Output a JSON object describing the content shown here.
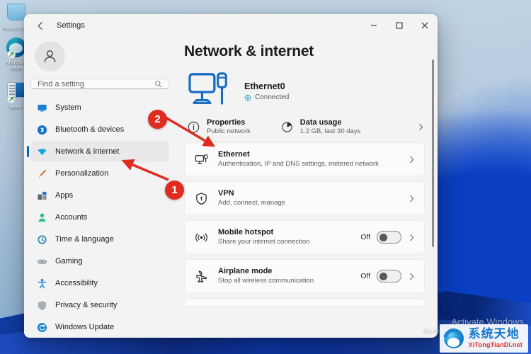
{
  "desktop": {
    "icons": [
      {
        "label": "Recycle Bin",
        "icon": "recycle-bin-icon",
        "shortcut": false
      },
      {
        "label": "Microsoft Edge",
        "icon": "microsoft-edge-icon",
        "shortcut": true
      },
      {
        "label": "taskm",
        "icon": "task-manager-icon",
        "shortcut": true
      }
    ]
  },
  "window": {
    "title": "Settings",
    "back_icon": "back-arrow-icon",
    "controls": {
      "minimize": "minimize-icon",
      "maximize": "maximize-icon",
      "close": "close-icon"
    }
  },
  "sidebar": {
    "avatar_icon": "user-avatar-icon",
    "search": {
      "placeholder": "Find a setting",
      "value": "",
      "icon": "search-icon"
    },
    "items": [
      {
        "label": "System",
        "icon": "system-icon",
        "active": false
      },
      {
        "label": "Bluetooth & devices",
        "icon": "bluetooth-icon",
        "active": false
      },
      {
        "label": "Network & internet",
        "icon": "wifi-icon",
        "active": true
      },
      {
        "label": "Personalization",
        "icon": "brush-icon",
        "active": false
      },
      {
        "label": "Apps",
        "icon": "apps-icon",
        "active": false
      },
      {
        "label": "Accounts",
        "icon": "accounts-icon",
        "active": false
      },
      {
        "label": "Time & language",
        "icon": "clock-icon",
        "active": false
      },
      {
        "label": "Gaming",
        "icon": "gamepad-icon",
        "active": false
      },
      {
        "label": "Accessibility",
        "icon": "accessibility-icon",
        "active": false
      },
      {
        "label": "Privacy & security",
        "icon": "shield-icon",
        "active": false
      },
      {
        "label": "Windows Update",
        "icon": "update-icon",
        "active": false
      }
    ]
  },
  "main": {
    "page_title": "Network & internet",
    "status": {
      "illustration_icon": "ethernet-monitor-icon",
      "adapter_name": "Ethernet0",
      "connection_state": "Connected",
      "state_icon": "globe-icon"
    },
    "quick_actions": [
      {
        "title": "Properties",
        "subtitle": "Public network",
        "icon": "info-icon"
      },
      {
        "title": "Data usage",
        "subtitle": "1.2 GB, last 30 days",
        "icon": "pie-chart-icon"
      }
    ],
    "quick_chevron_icon": "chevron-right-icon",
    "cards": [
      {
        "title": "Ethernet",
        "subtitle": "Authentication, IP and DNS settings, metered network",
        "icon": "ethernet-icon",
        "toggle": null,
        "chevron": "chevron-right-icon"
      },
      {
        "title": "VPN",
        "subtitle": "Add, connect, manage",
        "icon": "vpn-shield-icon",
        "toggle": null,
        "chevron": "chevron-right-icon"
      },
      {
        "title": "Mobile hotspot",
        "subtitle": "Share your internet connection",
        "icon": "hotspot-icon",
        "toggle": "Off",
        "chevron": "chevron-right-icon"
      },
      {
        "title": "Airplane mode",
        "subtitle": "Stop all wireless communication",
        "icon": "airplane-icon",
        "toggle": "Off",
        "chevron": "chevron-right-icon"
      }
    ]
  },
  "annotations": [
    {
      "number": "1",
      "target": "sidebar-item-network-internet"
    },
    {
      "number": "2",
      "target": "quick-action-properties"
    }
  ],
  "watermarks": {
    "activation_line1": "Activate Windows",
    "activation_line2": "Go to Settings to activate Windows.",
    "site_cn": "系统天地",
    "site_en": "XiTongTianDi.net"
  },
  "colors": {
    "accent": "#0067c0",
    "annotation_red": "#e02b20",
    "illustration_blue": "#1a6dc0",
    "brand_blue": "#1678c8",
    "brand_red": "#e03127"
  }
}
